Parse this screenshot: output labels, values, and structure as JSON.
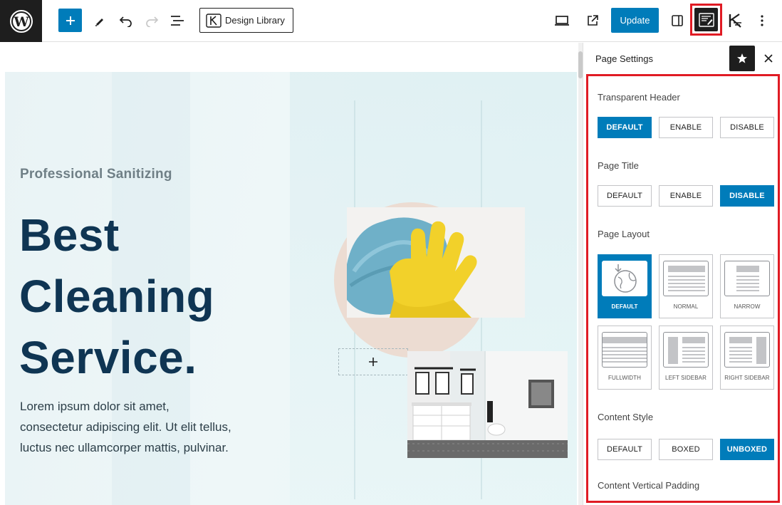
{
  "toolbar": {
    "design_library_label": "Design Library",
    "update_label": "Update"
  },
  "canvas": {
    "eyebrow": "Professional Sanitizing",
    "headline_line1": "Best",
    "headline_line2": "Cleaning",
    "headline_line3": "Service.",
    "body": "Lorem ipsum dolor sit amet, consectetur adipiscing elit. Ut elit tellus, luctus nec ullamcorper mattis, pulvinar."
  },
  "sidebar": {
    "title": "Page Settings",
    "transparent_header": {
      "label": "Transparent Header",
      "options": [
        "DEFAULT",
        "ENABLE",
        "DISABLE"
      ],
      "selected": "DEFAULT"
    },
    "page_title": {
      "label": "Page Title",
      "options": [
        "DEFAULT",
        "ENABLE",
        "DISABLE"
      ],
      "selected": "DISABLE"
    },
    "page_layout": {
      "label": "Page Layout",
      "options": [
        "DEFAULT",
        "NORMAL",
        "NARROW",
        "FULLWIDTH",
        "LEFT SIDEBAR",
        "RIGHT SIDEBAR"
      ],
      "selected": "DEFAULT"
    },
    "content_style": {
      "label": "Content Style",
      "options": [
        "DEFAULT",
        "BOXED",
        "UNBOXED"
      ],
      "selected": "UNBOXED"
    },
    "content_vertical_padding": {
      "label": "Content Vertical Padding"
    }
  },
  "colors": {
    "accent": "#007cba",
    "highlight_border": "#e01b24",
    "headline": "#0f3553",
    "dark": "#1e1e1e"
  },
  "icons": [
    "wordpress-logo-icon",
    "plus-icon",
    "pencil-icon",
    "undo-icon",
    "redo-icon",
    "list-view-icon",
    "kadence-icon",
    "desktop-preview-icon",
    "external-link-icon",
    "sidebar-toggle-icon",
    "page-settings-icon",
    "kadence-blocks-icon",
    "more-vertical-icon",
    "star-icon",
    "close-icon"
  ]
}
